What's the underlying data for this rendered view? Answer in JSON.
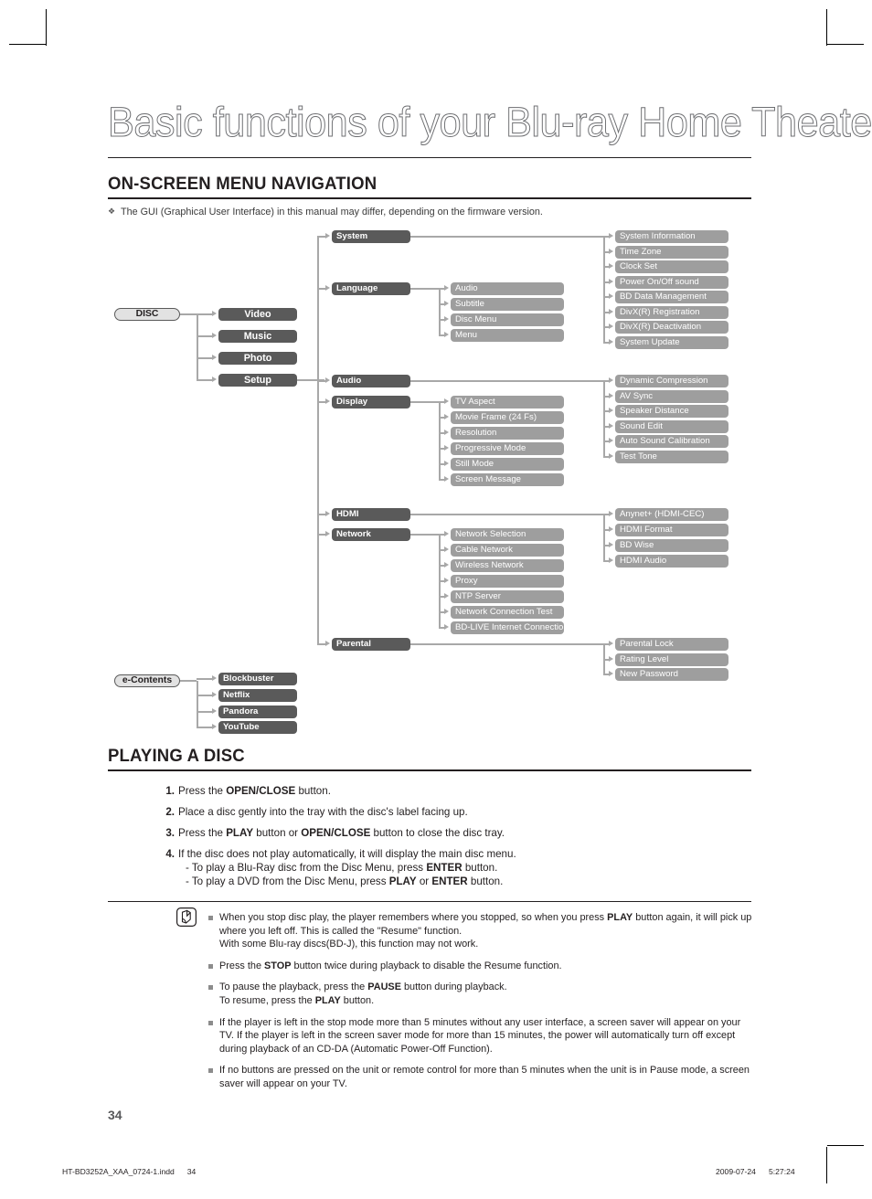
{
  "page_title": "Basic functions of your Blu-ray Home Theater",
  "sections": {
    "nav": {
      "heading": "ON-SCREEN MENU NAVIGATION",
      "gui_note": "The GUI (Graphical User Interface) in this manual may differ, depending on the firmware version.",
      "diamond": "❖"
    },
    "playing": {
      "heading": "PLAYING A DISC"
    }
  },
  "diagram": {
    "roots": [
      {
        "label": "DISC"
      },
      {
        "label": "e-Contents"
      }
    ],
    "disc_children": [
      "Video",
      "Music",
      "Photo",
      "Setup"
    ],
    "econtents_children": [
      "Blockbuster",
      "Netflix",
      "Pandora",
      "YouTube"
    ],
    "setup_children": [
      {
        "label": "System",
        "items": [
          "System Information",
          "Time Zone",
          "Clock Set",
          "Power On/Off sound",
          "BD Data Management",
          "DivX(R) Registration",
          "DivX(R) Deactivation",
          "System Update"
        ]
      },
      {
        "label": "Language",
        "items": [
          "Audio",
          "Subtitle",
          "Disc Menu",
          "Menu"
        ]
      },
      {
        "label": "Audio",
        "items": [
          "Dynamic Compression",
          "AV Sync",
          "Speaker Distance",
          "Sound Edit",
          "Auto Sound Calibration",
          "Test Tone"
        ]
      },
      {
        "label": "Display",
        "items": [
          "TV Aspect",
          "Movie Frame (24 Fs)",
          "Resolution",
          "Progressive Mode",
          "Still Mode",
          "Screen Message"
        ]
      },
      {
        "label": "HDMI",
        "items": [
          "Anynet+ (HDMI-CEC)",
          "HDMI Format",
          "BD Wise",
          "HDMI Audio"
        ]
      },
      {
        "label": "Network",
        "items": [
          "Network Selection",
          "Cable Network",
          "Wireless Network",
          "Proxy",
          "NTP Server",
          "Network Connection Test",
          "BD-LIVE Internet Connection"
        ]
      },
      {
        "label": "Parental",
        "items": [
          "Parental Lock",
          "Rating Level",
          "New Password"
        ]
      }
    ],
    "colors": {
      "dark_box": "#5a5a5a",
      "mid_box": "#9e9e9e",
      "root_box": "#e2e2e2",
      "connector": "#a8a8a8"
    }
  },
  "steps": [
    {
      "num": "1.",
      "html": "Press the <b>OPEN/CLOSE</b> button."
    },
    {
      "num": "2.",
      "html": "Place a disc gently into the tray with the disc's label facing up."
    },
    {
      "num": "3.",
      "html": "Press the <b>PLAY</b> button or <b>OPEN/CLOSE</b> button to close the disc tray."
    },
    {
      "num": "4.",
      "html": "If the disc does not play automatically, it will display the main disc menu.<span class=\"sub\">- To play a Blu-Ray disc from the Disc Menu, press <b>ENTER</b> button.</span><span class=\"sub\">- To play a DVD from the Disc Menu, press <b>PLAY</b> or <b>ENTER</b> button.</span>"
    }
  ],
  "notes": [
    {
      "html": "When you stop disc play, the player remembers where you stopped, so when you press <b>PLAY</b> button again, it will pick up where you left off. This is called the \"Resume\" function.<br>With some Blu-ray discs(BD-J), this function may not work."
    },
    {
      "html": "Press the <b>STOP</b> button twice during playback to disable the Resume function."
    },
    {
      "html": "To pause the playback, press the <b>PAUSE</b> button during playback.<br>To resume, press the <b>PLAY</b> button."
    },
    {
      "html": "If the player is left in the stop mode more than 5 minutes without any user interface, a screen saver will appear on your TV. If the player is left in the screen saver mode for more than 15 minutes, the power will automatically turn off except during playback of an CD-DA (Automatic Power-Off Function)."
    },
    {
      "html": "If no buttons are pressed on the unit or remote control for more than 5 minutes when the unit is in Pause mode, a screen saver will appear on your TV."
    }
  ],
  "footer": {
    "page_number": "34",
    "file_name": "HT-BD3252A_XAA_0724-1.indd",
    "file_page": "34",
    "date": "2009-07-24",
    "time": "5:27:24"
  }
}
